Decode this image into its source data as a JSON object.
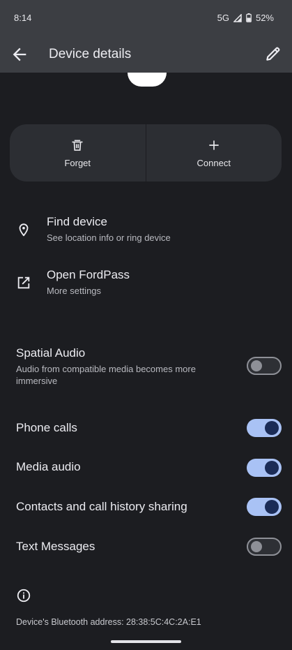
{
  "status": {
    "time": "8:14",
    "network": "5G",
    "battery": "52%"
  },
  "header": {
    "title": "Device details"
  },
  "actions": [
    {
      "label": "Forget",
      "icon": "trash-icon"
    },
    {
      "label": "Connect",
      "icon": "plus-icon"
    }
  ],
  "menu": [
    {
      "title": "Find device",
      "subtitle": "See location info or ring device",
      "icon": "location-pin-icon"
    },
    {
      "title": "Open FordPass",
      "subtitle": "More settings",
      "icon": "open-external-icon"
    }
  ],
  "settings": [
    {
      "title": "Spatial Audio",
      "subtitle": "Audio from compatible media becomes more immersive",
      "enabled": false
    },
    {
      "title": "Phone calls",
      "enabled": true
    },
    {
      "title": "Media audio",
      "enabled": true
    },
    {
      "title": "Contacts and call history sharing",
      "enabled": true
    },
    {
      "title": "Text Messages",
      "enabled": false
    }
  ],
  "footer": {
    "bt_address": "Device's Bluetooth address: 28:38:5C:4C:2A:E1"
  },
  "colors": {
    "background": "#1c1d21",
    "toggle_on_track": "#a9c2f5",
    "toggle_on_knob": "#1b2c57"
  }
}
